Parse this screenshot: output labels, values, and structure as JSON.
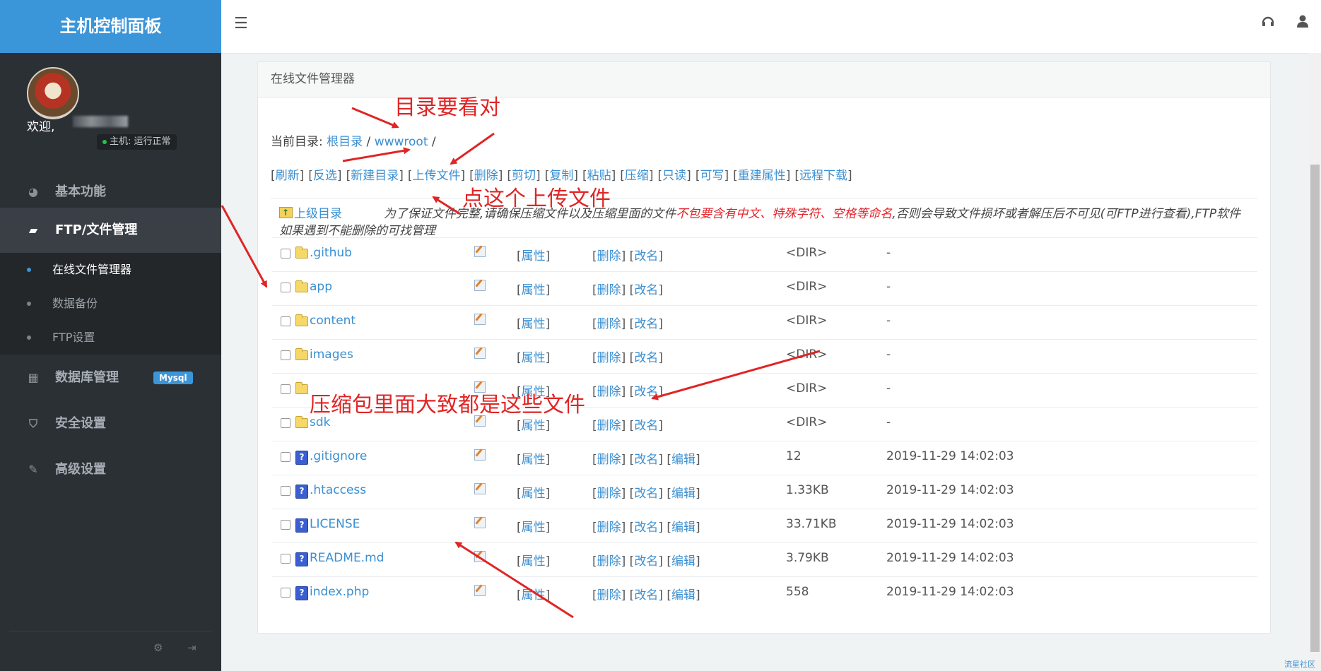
{
  "sidebar": {
    "brand": "主机控制面板",
    "welcome": "欢迎,",
    "host_status": "主机: 运行正常",
    "nav": [
      {
        "label": "基本功能",
        "icon": "dashboard-icon"
      },
      {
        "label": "FTP/文件管理",
        "icon": "folder-open-icon"
      },
      {
        "label": "数据库管理",
        "icon": "table-icon",
        "badge": "Mysql"
      },
      {
        "label": "安全设置",
        "icon": "shield-icon"
      },
      {
        "label": "高级设置",
        "icon": "edit-icon"
      }
    ],
    "submenu": [
      "在线文件管理器",
      "数据备份",
      "FTP设置"
    ]
  },
  "header": {
    "menu_toggle_icon": "menu-icon",
    "right_icons": [
      "headset-icon",
      "user-icon"
    ]
  },
  "panel": {
    "title": "在线文件管理器",
    "current_dir_label": "当前目录:",
    "breadcrumb": [
      "根目录",
      "wwwroot"
    ],
    "toolbar": [
      "刷新",
      "反选",
      "新建目录",
      "上传文件",
      "删除",
      "剪切",
      "复制",
      "粘贴",
      "压缩",
      "只读",
      "可写",
      "重建属性",
      "远程下载"
    ],
    "parent_dir": "上级目录",
    "notice_prefix": "为了保证文件完整,请确保压缩文件以及压缩里面的文件",
    "notice_warning": "不包要含有中文、特殊字符、空格等命名",
    "notice_suffix": ",否则会导致文件损坏或者解压后不可见(可FTP进行查看),FTP软件如果遇到不能删除的可找管理",
    "files": [
      {
        "name": ".github",
        "type": "dir",
        "size": "<DIR>",
        "mtime": "-"
      },
      {
        "name": "app",
        "type": "dir",
        "size": "<DIR>",
        "mtime": "-"
      },
      {
        "name": "content",
        "type": "dir",
        "size": "<DIR>",
        "mtime": "-"
      },
      {
        "name": "images",
        "type": "dir",
        "size": "<DIR>",
        "mtime": "-"
      },
      {
        "name": "",
        "type": "dir",
        "size": "<DIR>",
        "mtime": "-"
      },
      {
        "name": "sdk",
        "type": "dir",
        "size": "<DIR>",
        "mtime": "-"
      },
      {
        "name": ".gitignore",
        "type": "file",
        "size": "12",
        "mtime": "2019-11-29 14:02:03"
      },
      {
        "name": ".htaccess",
        "type": "file",
        "size": "1.33KB",
        "mtime": "2019-11-29 14:02:03"
      },
      {
        "name": "LICENSE",
        "type": "file",
        "size": "33.71KB",
        "mtime": "2019-11-29 14:02:03"
      },
      {
        "name": "README.md",
        "type": "file",
        "size": "3.79KB",
        "mtime": "2019-11-29 14:02:03"
      },
      {
        "name": "index.php",
        "type": "file",
        "size": "558",
        "mtime": "2019-11-29 14:02:03"
      }
    ],
    "actions": {
      "attr": "属性",
      "delete": "删除",
      "rename": "改名",
      "edit": "编辑"
    }
  },
  "annotations": {
    "dir_note": "目录要看对",
    "upload_note": "点这个上传文件",
    "contents_note": "压缩包里面大致都是这些文件",
    "color": "#e02525"
  },
  "corner_text": "流星社区"
}
